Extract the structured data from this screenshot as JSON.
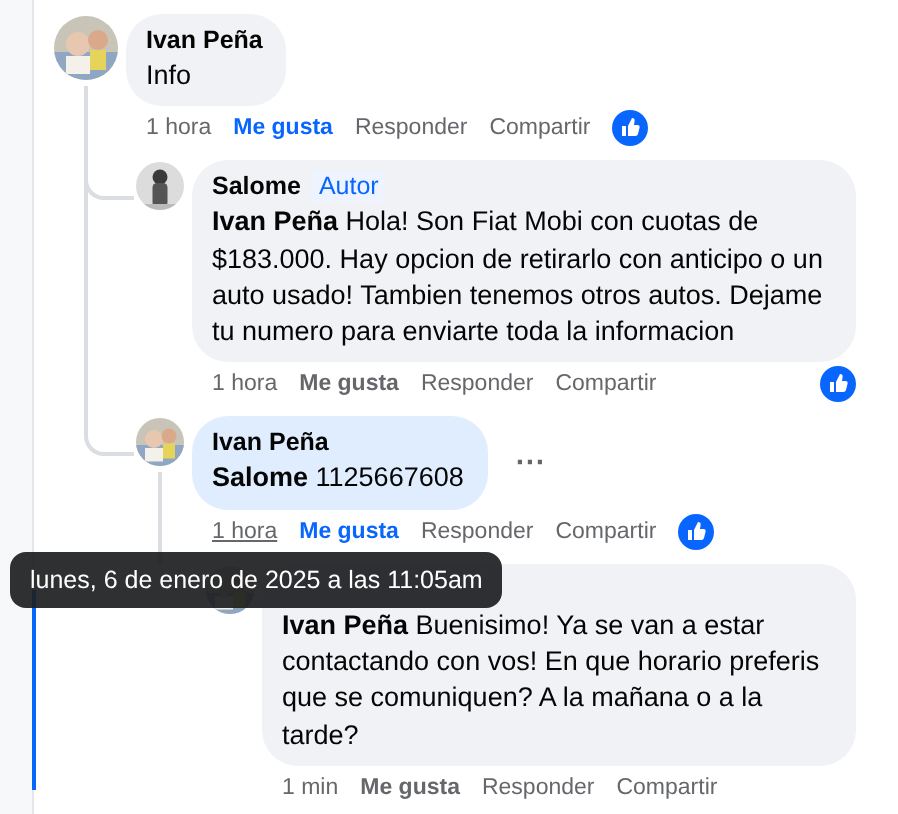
{
  "comments": [
    {
      "author": "Ivan Peña",
      "text": "Info",
      "time": "1 hora",
      "time_hovered": false,
      "like": "Me gusta",
      "liked": true,
      "reply": "Responder",
      "share": "Compartir",
      "reacted": true,
      "children": [
        {
          "author": "Salome",
          "badge": "Autor",
          "text": "**Ivan Peña** Hola! Son Fiat Mobi con cuotas de $183.000. Hay opcion de retirarlo con anticipo o un auto usado! Tambien tenemos otros autos. Dejame tu numero para enviarte toda la informacion",
          "time": "1 hora",
          "time_hovered": false,
          "like": "Me gusta",
          "liked": false,
          "reply": "Responder",
          "share": "Compartir",
          "reacted": true
        },
        {
          "author": "Ivan Peña",
          "text": "**Salome** 1125667608",
          "highlighted": true,
          "more": "···",
          "time": "1 hora",
          "time_hovered": true,
          "tooltip": "lunes, 6 de enero de 2025 a las 11:05am",
          "like": "Me gusta",
          "liked": true,
          "reply": "Responder",
          "share": "Compartir",
          "reacted": true,
          "children": [
            {
              "text": "**Ivan Peña** Buenisimo! Ya se van a estar contactando con vos! En que horario preferis que se comuniquen? A la mañana o a la tarde?",
              "time": "1 min",
              "time_hovered": false,
              "like": "Me gusta",
              "liked": false,
              "reply": "Responder",
              "share": "Compartir",
              "reacted": false
            }
          ]
        }
      ]
    }
  ]
}
